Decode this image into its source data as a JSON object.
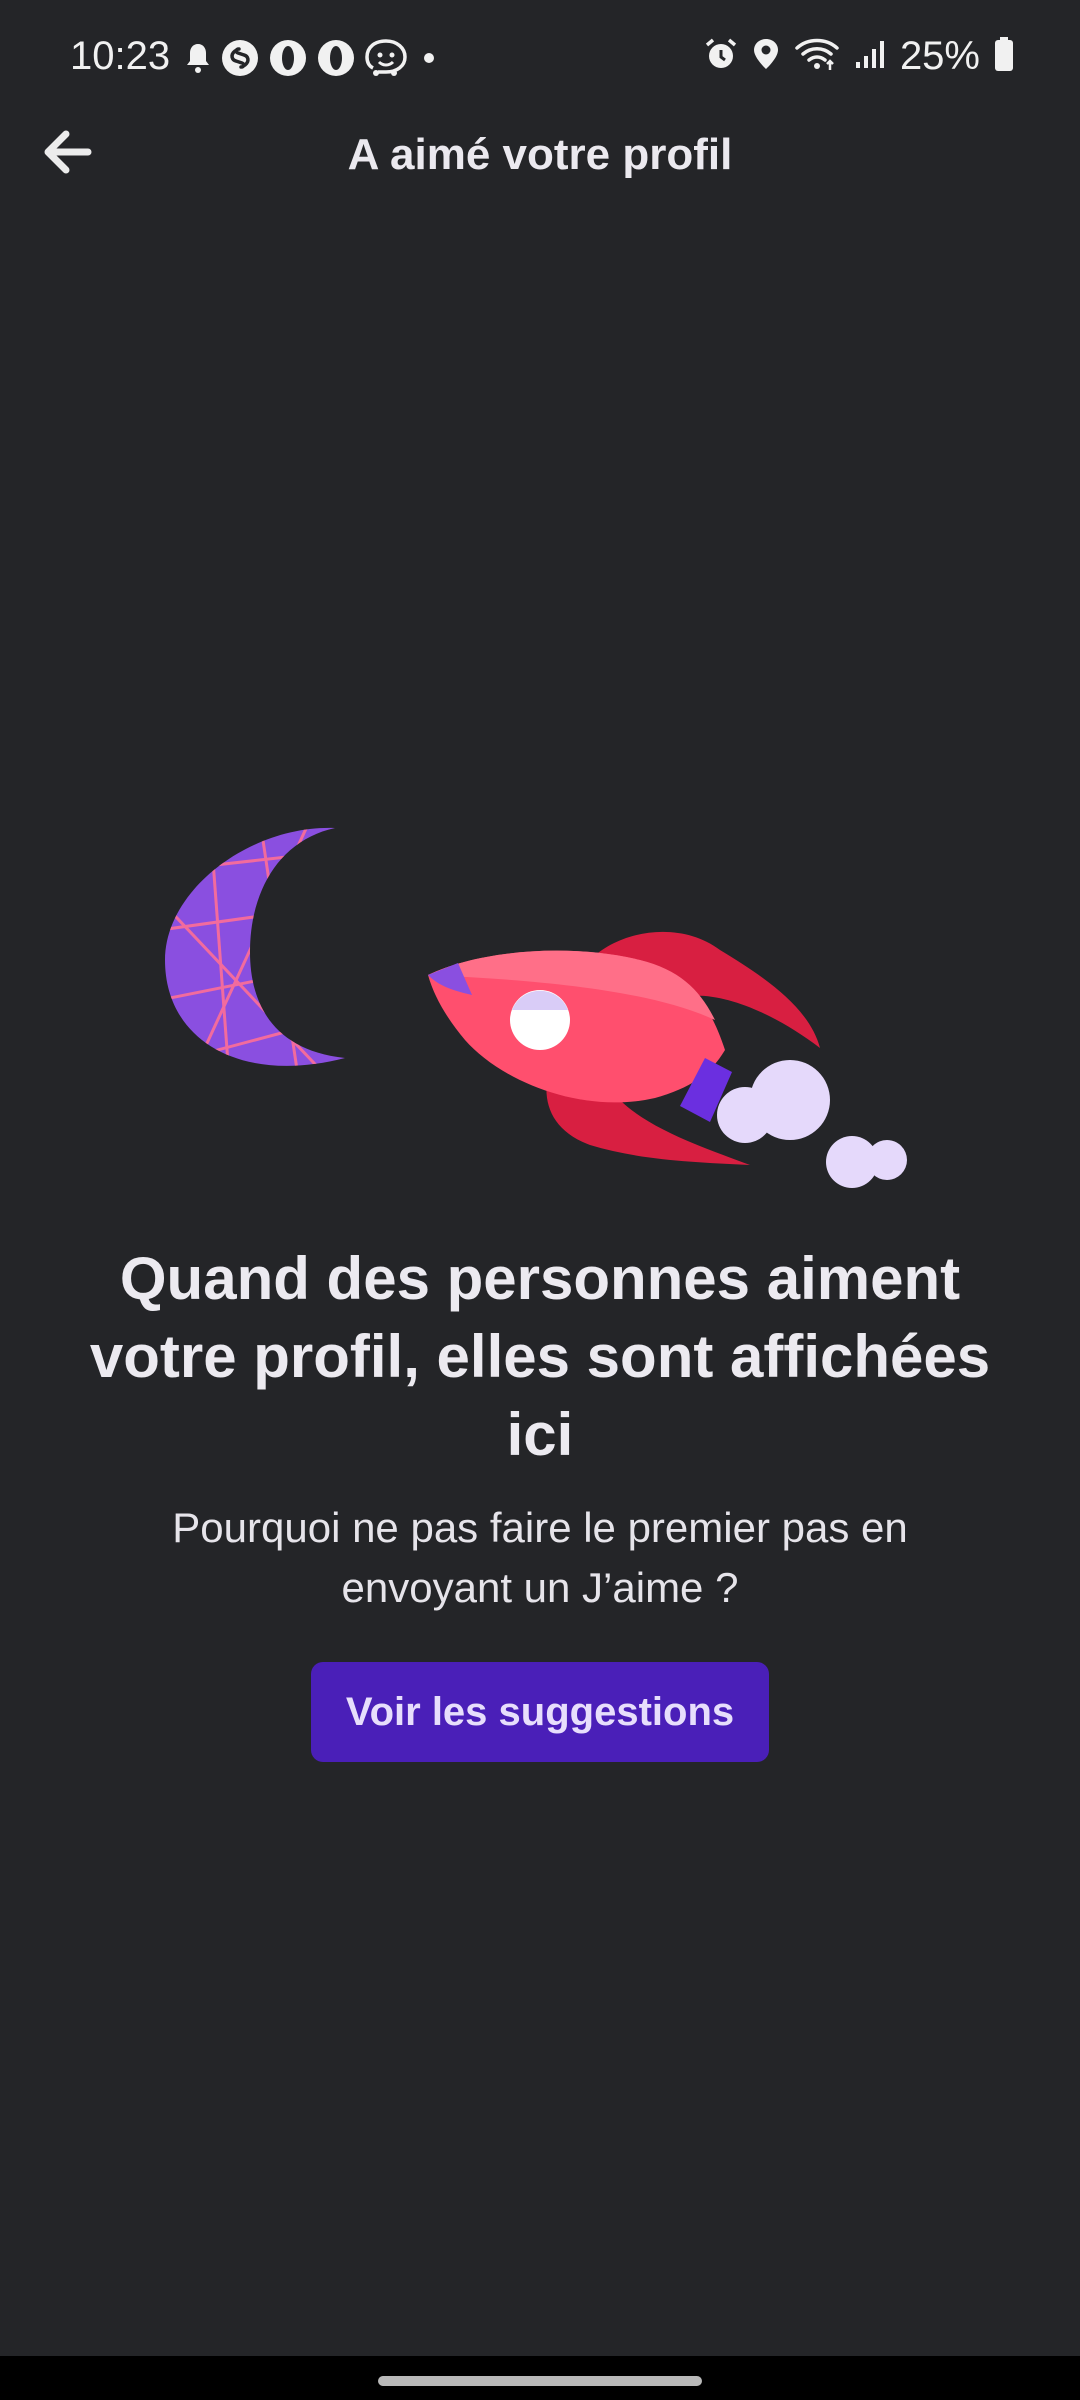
{
  "status_bar": {
    "time": "10:23",
    "battery": "25%",
    "left_icons": [
      "bell-icon",
      "shazam-icon",
      "opera-icon",
      "opera-icon",
      "waze-icon",
      "dot-icon"
    ],
    "right_icons": [
      "alarm-icon",
      "location-icon",
      "wifi-icon",
      "signal-icon",
      "battery-icon"
    ]
  },
  "header": {
    "back_icon": "arrow-left-icon",
    "title": "A aimé votre profil"
  },
  "empty_state": {
    "headline": "Quand des personnes aiment votre profil, elles sont affichées ici",
    "subtext": "Pourquoi ne pas faire le premier pas en envoyant un J’aime ?",
    "button_label": "Voir les suggestions"
  },
  "colors": {
    "background": "#242528",
    "button": "#4a1fb8",
    "moon": "#8a4fe0",
    "rocket": "#ff4f6e"
  }
}
